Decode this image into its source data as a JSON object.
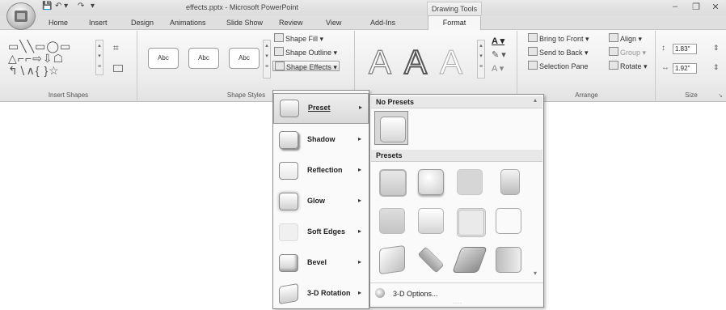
{
  "window": {
    "title": "effects.pptx - Microsoft PowerPoint",
    "contextual_tab": "Drawing Tools",
    "controls": [
      "–",
      "❐",
      "✕"
    ]
  },
  "qat": {
    "save": "💾",
    "undo": "↶ ▾",
    "redo": "↷",
    "customize": "▾"
  },
  "tabs": [
    "Home",
    "Insert",
    "Design",
    "Animations",
    "Slide Show",
    "Review",
    "View",
    "Add-Ins",
    "Format"
  ],
  "ribbon": {
    "insert_shapes": {
      "label": "Insert Shapes",
      "row1": "▭╲╲▭◯▭",
      "row2": "△⌐⌐⇨⇩☖",
      "row3": "↰∖∧{ }☆"
    },
    "shape_styles": {
      "label": "Shape Styles",
      "thumbs": [
        "Abc",
        "Abc",
        "Abc"
      ],
      "fill": "Shape Fill ▾",
      "outline": "Shape Outline ▾",
      "effects": "Shape Effects ▾"
    },
    "wordart_styles": {
      "letters": [
        "A",
        "A",
        "A"
      ]
    },
    "arrange": {
      "label": "Arrange",
      "bring_front": "Bring to Front ▾",
      "send_back": "Send to Back ▾",
      "selection_pane": "Selection Pane",
      "align": "Align ▾",
      "group": "Group ▾",
      "rotate": "Rotate ▾"
    },
    "size": {
      "label": "Size",
      "height": "1.83\"",
      "width": "1.92\""
    }
  },
  "effects_menu": {
    "items": [
      {
        "label": "Preset",
        "selected": true
      },
      {
        "label": "Shadow"
      },
      {
        "label": "Reflection"
      },
      {
        "label": "Glow"
      },
      {
        "label": "Soft Edges"
      },
      {
        "label": "Bevel"
      },
      {
        "label": "3-D Rotation"
      }
    ],
    "arrow": "▸"
  },
  "preset_gallery": {
    "no_presets_header": "No Presets",
    "presets_header": "Presets",
    "options_label": "3-D Options...",
    "grip": "....",
    "scroll_up": "▴",
    "scroll_down": "▾"
  },
  "colors": {
    "accent": "#e8b24a",
    "ribbon": "#ececec",
    "menu_bg": "#fafafa"
  }
}
